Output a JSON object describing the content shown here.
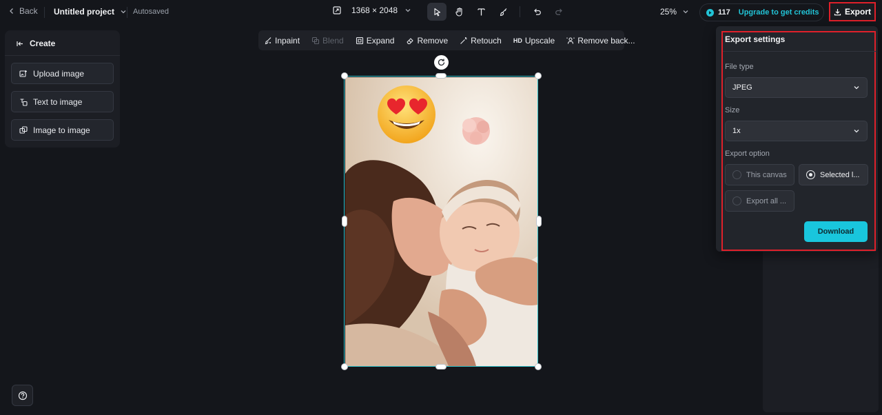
{
  "topbar": {
    "back_label": "Back",
    "project_title": "Untitled project",
    "autosaved": "Autosaved",
    "dimensions": "1368 × 2048",
    "zoom": "25%",
    "credits_count": "117",
    "upgrade_label": "Upgrade to get credits",
    "export_label": "Export"
  },
  "left_panel": {
    "header": "Create",
    "items": [
      {
        "label": "Upload image",
        "icon": "upload-image-icon"
      },
      {
        "label": "Text to image",
        "icon": "text-to-image-icon"
      },
      {
        "label": "Image to image",
        "icon": "image-to-image-icon"
      }
    ]
  },
  "context_toolbar": {
    "items": [
      {
        "label": "Inpaint",
        "enabled": true
      },
      {
        "label": "Blend",
        "enabled": false
      },
      {
        "label": "Expand",
        "enabled": true
      },
      {
        "label": "Remove",
        "enabled": true
      },
      {
        "label": "Retouch",
        "enabled": true
      },
      {
        "label": "Upscale",
        "enabled": true,
        "prefix": "HD"
      },
      {
        "label": "Remove back...",
        "enabled": true
      }
    ]
  },
  "export_settings": {
    "title": "Export settings",
    "file_type_label": "File type",
    "file_type_value": "JPEG",
    "size_label": "Size",
    "size_value": "1x",
    "export_option_label": "Export option",
    "options": [
      {
        "label": "This canvas",
        "selected": false
      },
      {
        "label": "Selected l...",
        "selected": true
      },
      {
        "label": "Export all ...",
        "selected": false
      }
    ],
    "download_label": "Download"
  },
  "colors": {
    "accent": "#19c6dd",
    "highlight": "#e0202a",
    "selection": "#2fc0c9"
  }
}
